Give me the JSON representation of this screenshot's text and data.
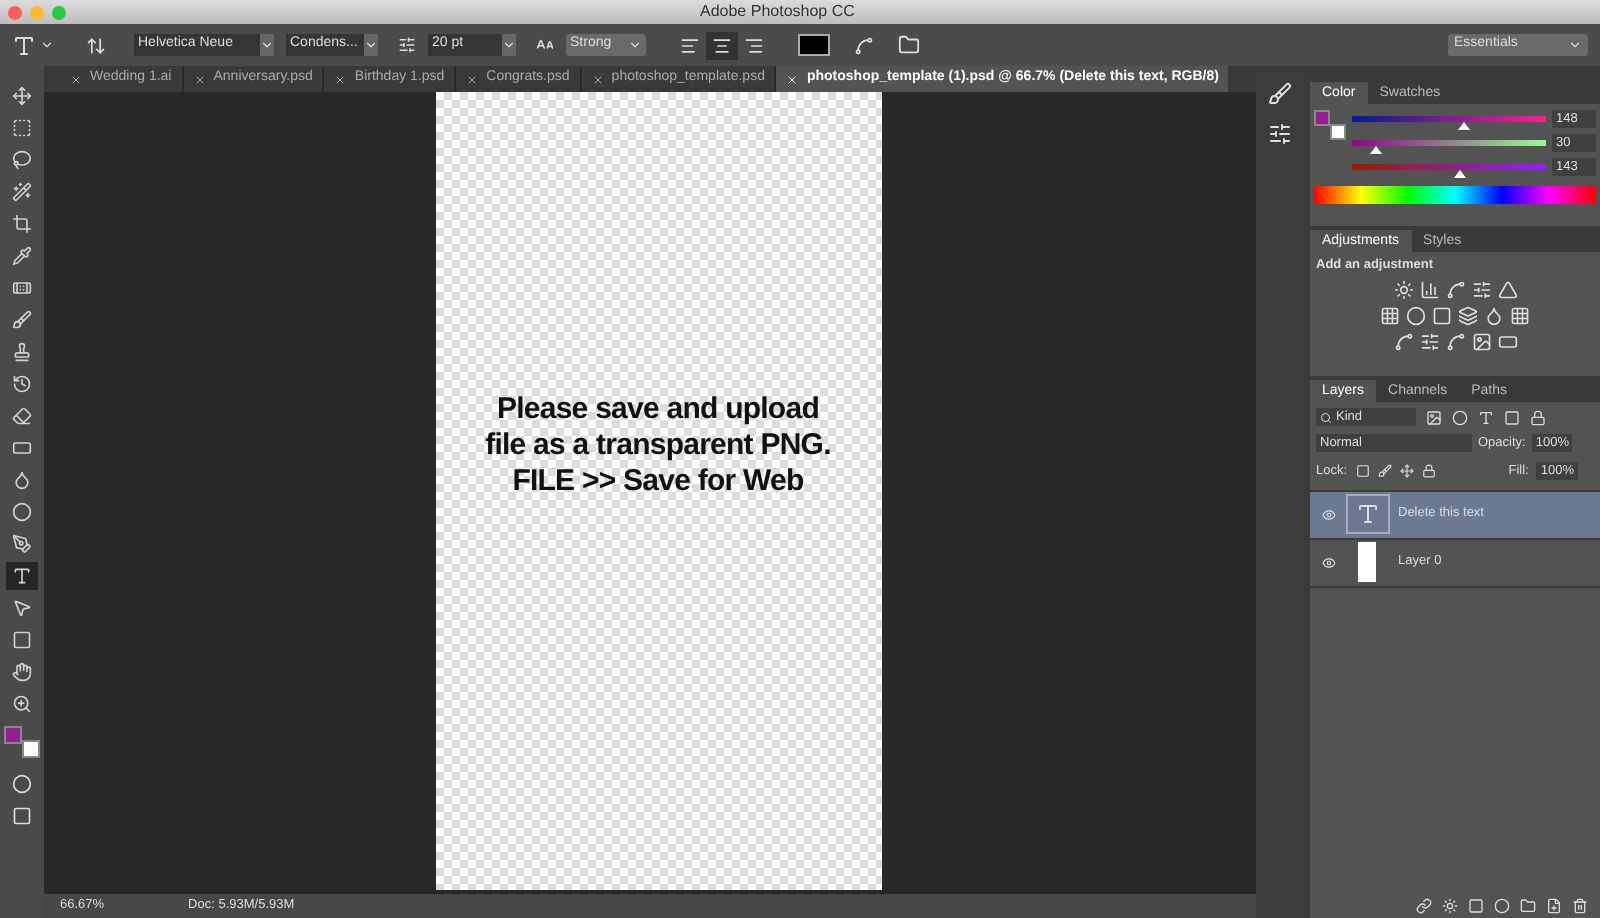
{
  "window": {
    "title": "Adobe Photoshop CC"
  },
  "options_bar": {
    "font_family": "Helvetica Neue",
    "font_style": "Condens...",
    "font_size": "20 pt",
    "antialias": "Strong",
    "align": [
      {
        "kind": "left",
        "selected": false
      },
      {
        "kind": "center",
        "selected": true
      },
      {
        "kind": "right",
        "selected": false
      }
    ],
    "workspace": "Essentials"
  },
  "tabs": [
    {
      "label": "Wedding 1.ai",
      "selected": false
    },
    {
      "label": "Anniversary.psd",
      "selected": false
    },
    {
      "label": "Birthday 1.psd",
      "selected": false
    },
    {
      "label": "Congrats.psd",
      "selected": false
    },
    {
      "label": "photoshop_template.psd",
      "selected": false
    },
    {
      "label": "photoshop_template (1).psd @ 66.7% (Delete this text, RGB/8)",
      "selected": true
    }
  ],
  "tools": [
    {
      "kind": "move",
      "selected": false
    },
    {
      "kind": "marquee",
      "selected": false
    },
    {
      "kind": "lasso",
      "selected": false
    },
    {
      "kind": "wand",
      "selected": false
    },
    {
      "kind": "crop",
      "selected": false
    },
    {
      "kind": "eyedropper",
      "selected": false
    },
    {
      "kind": "heal",
      "selected": false
    },
    {
      "kind": "brush",
      "selected": false
    },
    {
      "kind": "stamp",
      "selected": false
    },
    {
      "kind": "history",
      "selected": false
    },
    {
      "kind": "eraser",
      "selected": false
    },
    {
      "kind": "gradient",
      "selected": false
    },
    {
      "kind": "blur",
      "selected": false
    },
    {
      "kind": "dodge",
      "selected": false
    },
    {
      "kind": "pen",
      "selected": false
    },
    {
      "kind": "type",
      "selected": true
    },
    {
      "kind": "select",
      "selected": false
    },
    {
      "kind": "shape",
      "selected": false
    },
    {
      "kind": "hand",
      "selected": false
    },
    {
      "kind": "zoom",
      "selected": false
    }
  ],
  "canvas": {
    "lines": [
      "Please save and upload",
      "file as a transparent PNG.",
      "FILE >> Save for Web"
    ]
  },
  "color_panel": {
    "tabs": [
      {
        "label": "Color",
        "selected": true
      },
      {
        "label": "Swatches",
        "selected": false
      }
    ],
    "channels": [
      {
        "value": "148",
        "level": 0.58
      },
      {
        "value": "30",
        "level": 0.12
      },
      {
        "value": "143",
        "level": 0.56
      }
    ]
  },
  "adjustments_panel": {
    "tabs": [
      {
        "label": "Adjustments",
        "selected": true
      },
      {
        "label": "Styles",
        "selected": false
      }
    ],
    "title": "Add an adjustment"
  },
  "layers_panel": {
    "tabs": [
      {
        "label": "Layers",
        "selected": true
      },
      {
        "label": "Channels",
        "selected": false
      },
      {
        "label": "Paths",
        "selected": false
      }
    ],
    "filter": "Kind",
    "blend_mode": "Normal",
    "opacity_label": "Opacity:",
    "opacity": "100%",
    "lock_label": "Lock:",
    "fill_label": "Fill:",
    "fill": "100%",
    "layers": [
      {
        "name": "Delete this text",
        "kind": "text",
        "visible": true,
        "selected": true
      },
      {
        "name": "Layer 0",
        "kind": "pixel",
        "visible": true,
        "selected": false
      }
    ]
  },
  "status_bar": {
    "zoom": "66.67%",
    "doc": "Doc: 5.93M/5.93M"
  }
}
